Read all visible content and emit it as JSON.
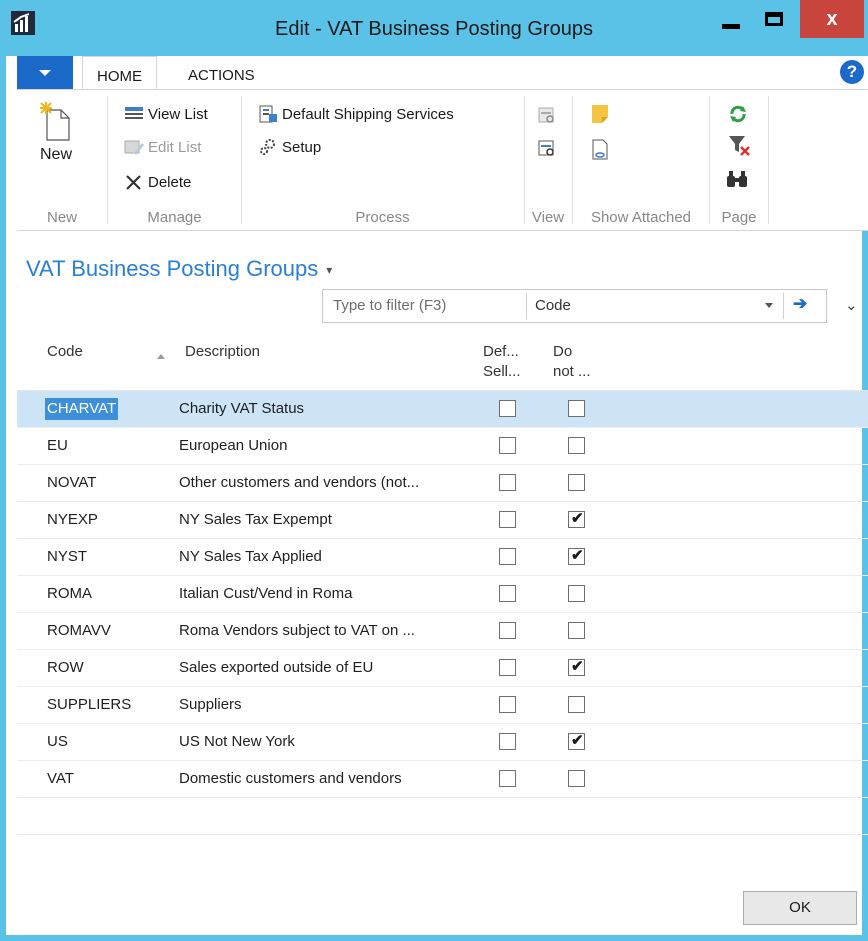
{
  "window": {
    "title": "Edit - VAT Business Posting Groups",
    "close_glyph": "x"
  },
  "tabs": [
    {
      "label": "HOME"
    },
    {
      "label": "ACTIONS"
    }
  ],
  "help_glyph": "?",
  "ribbon": {
    "new_group": {
      "new_label": "New",
      "group_label": "New"
    },
    "manage_group": {
      "view_list": "View List",
      "edit_list": "Edit List",
      "delete": "Delete",
      "group_label": "Manage"
    },
    "process_group": {
      "default_shipping": "Default Shipping Services",
      "setup": "Setup",
      "group_label": "Process"
    },
    "view_group": {
      "group_label": "View"
    },
    "show_attached_group": {
      "group_label": "Show Attached"
    },
    "page_group": {
      "group_label": "Page"
    }
  },
  "page": {
    "title": "VAT Business Posting Groups",
    "title_caret": "▾",
    "filter_placeholder": "Type to filter (F3)",
    "filter_field": "Code",
    "go_glyph": "➔",
    "expand_glyph": "⌄"
  },
  "table": {
    "headers": {
      "code": "Code",
      "description": "Description",
      "def_line1": "Def...",
      "def_line2": "Sell...",
      "donot_line1": "Do",
      "donot_line2": "not ..."
    },
    "rows": [
      {
        "code": "CHARVAT",
        "description": "Charity VAT Status",
        "def": false,
        "donot": false
      },
      {
        "code": "EU",
        "description": "European Union",
        "def": false,
        "donot": false
      },
      {
        "code": "NOVAT",
        "description": "Other customers and vendors (not...",
        "def": false,
        "donot": false
      },
      {
        "code": "NYEXP",
        "description": "NY Sales Tax Expempt",
        "def": false,
        "donot": true
      },
      {
        "code": "NYST",
        "description": "NY Sales Tax Applied",
        "def": false,
        "donot": true
      },
      {
        "code": "ROMA",
        "description": "Italian Cust/Vend in Roma",
        "def": false,
        "donot": false
      },
      {
        "code": "ROMAVV",
        "description": "Roma Vendors subject to VAT on ...",
        "def": false,
        "donot": false
      },
      {
        "code": "ROW",
        "description": "Sales exported outside of EU",
        "def": false,
        "donot": true
      },
      {
        "code": "SUPPLIERS",
        "description": "Suppliers",
        "def": false,
        "donot": false
      },
      {
        "code": "US",
        "description": "US Not New York",
        "def": false,
        "donot": true
      },
      {
        "code": "VAT",
        "description": "Domestic customers and vendors",
        "def": false,
        "donot": false
      }
    ],
    "check_glyph": "✔"
  },
  "footer": {
    "ok_label": "OK"
  },
  "colors": {
    "titlebar": "#5bc2e7",
    "accent": "#1b6ac9",
    "title_text": "#2a7fd4",
    "selected_row": "#cde4f7",
    "close": "#c7453c"
  }
}
